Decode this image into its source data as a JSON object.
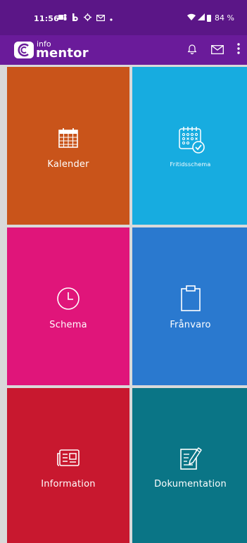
{
  "status_bar": {
    "time": "11:56",
    "notification_icons": [
      "teams-icon",
      "b-icon",
      "settings-icon",
      "gmail-icon",
      "dot-icon"
    ],
    "battery": "84 %"
  },
  "app_bar": {
    "logo_small": "info",
    "logo_large": "mentor",
    "actions": [
      "bell-icon",
      "mail-icon",
      "more-vertical-icon"
    ]
  },
  "tiles": [
    {
      "label": "Kalender",
      "color": "#c9541a",
      "icon": "calendar-icon"
    },
    {
      "label": "Fritidsschema",
      "color": "#17ace0",
      "icon": "schedule-check-icon"
    },
    {
      "label": "Schema",
      "color": "#e0157a",
      "icon": "clock-icon"
    },
    {
      "label": "Frånvaro",
      "color": "#2a79cf",
      "icon": "clipboard-icon"
    },
    {
      "label": "Information",
      "color": "#c8182f",
      "icon": "newspaper-icon"
    },
    {
      "label": "Dokumentation",
      "color": "#0a7586",
      "icon": "edit-document-icon"
    }
  ]
}
